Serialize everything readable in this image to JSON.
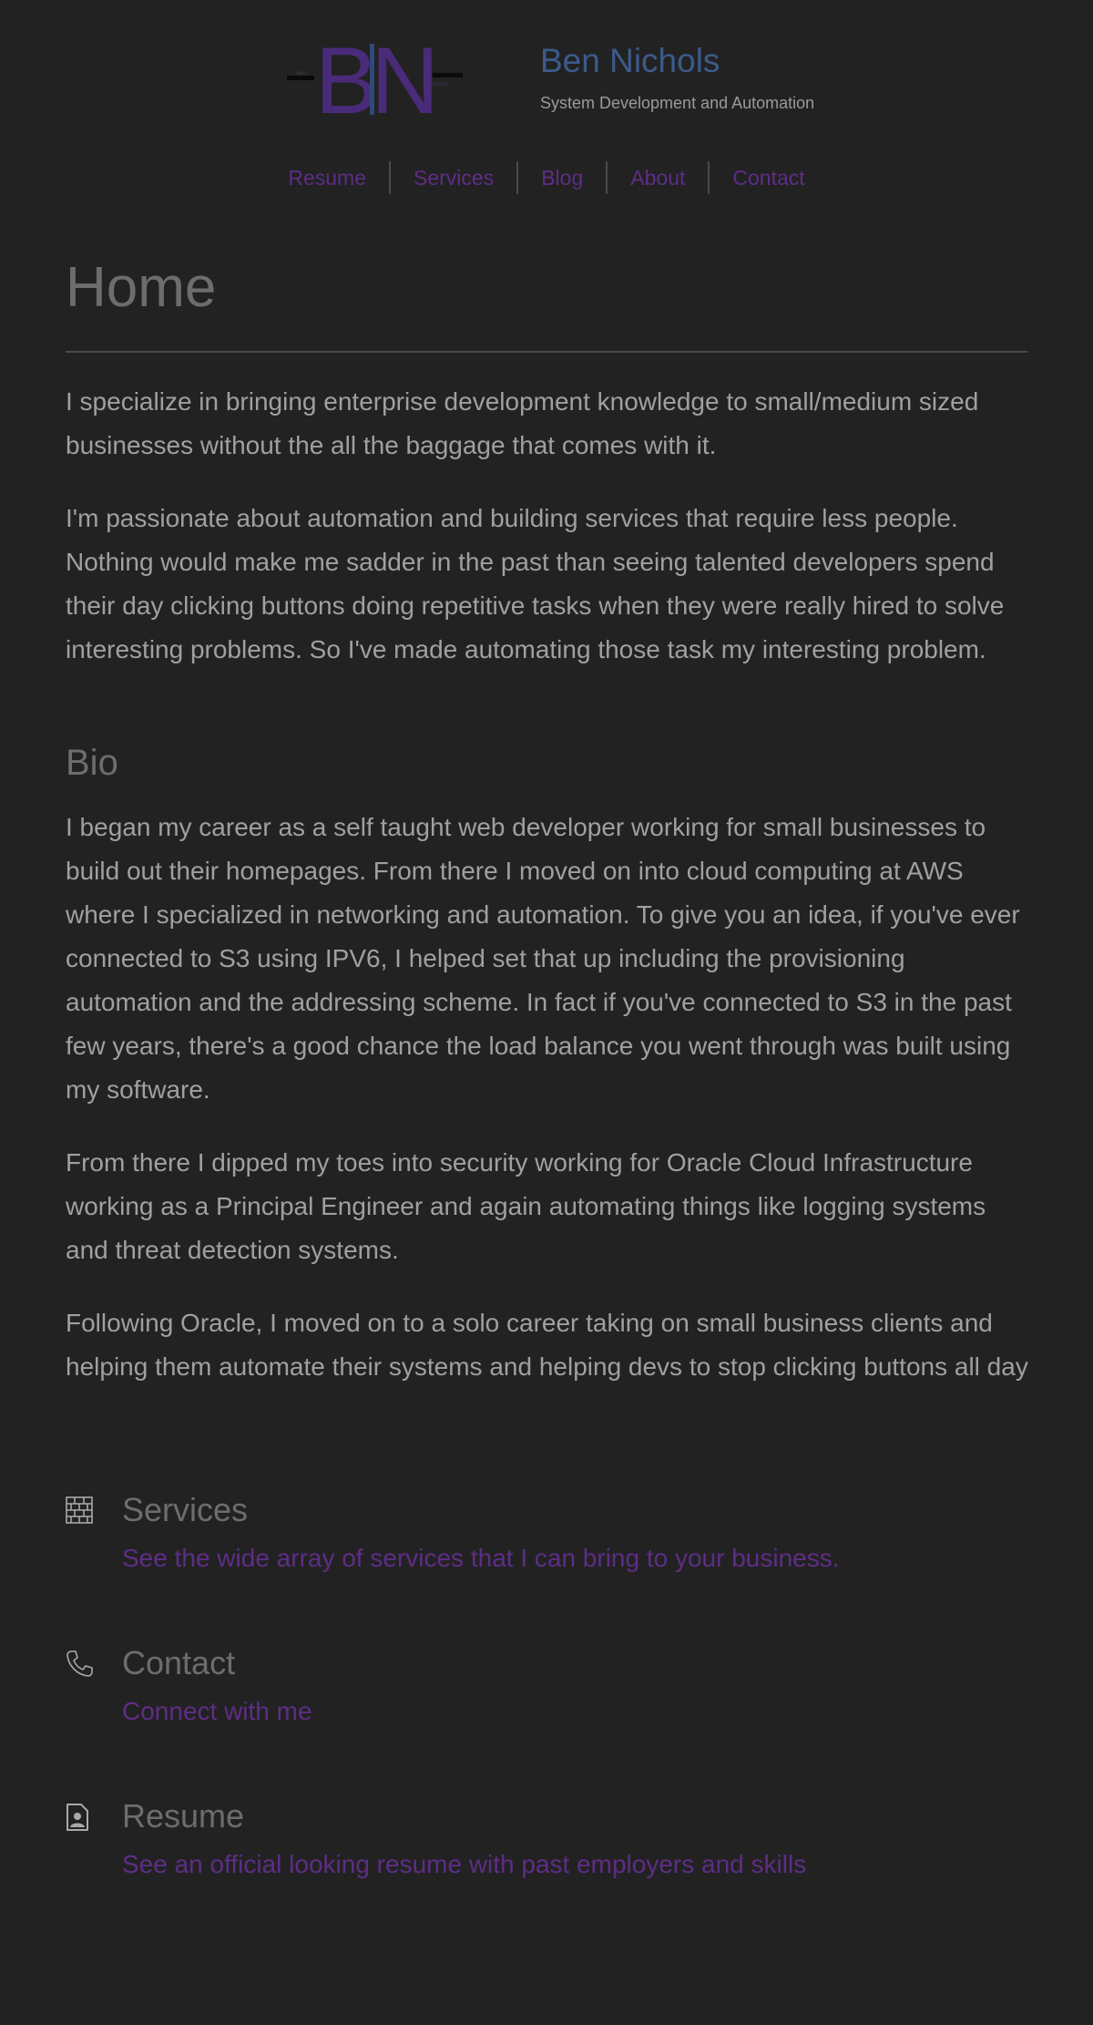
{
  "header": {
    "logo_letters": "BN",
    "logo_left_text": "Ben",
    "logo_right_text": "Nichols",
    "site_title": "Ben Nichols",
    "site_subtitle": "System Development and Automation",
    "brand_color": "#4a2b7a",
    "title_color": "#3c5a8a"
  },
  "nav": {
    "items": [
      {
        "label": "Resume"
      },
      {
        "label": "Services"
      },
      {
        "label": "Blog"
      },
      {
        "label": "About"
      },
      {
        "label": "Contact"
      }
    ],
    "link_color": "#5e2d86"
  },
  "main": {
    "title": "Home",
    "intro_paragraphs": [
      "I specialize in bringing enterprise development knowledge to small/medium sized businesses without the all the baggage that comes with it.",
      "I'm passionate about automation and building services that require less people. Nothing would make me sadder in the past than seeing talented developers spend their day clicking buttons doing repetitive tasks when they were really hired to solve interesting problems. So I've made automating those task my interesting problem."
    ],
    "bio_heading": "Bio",
    "bio_paragraphs": [
      "I began my career as a self taught web developer working for small businesses to build out their homepages. From there I moved on into cloud computing at AWS where I specialized in networking and automation. To give you an idea, if you've ever connected to S3 using IPV6, I helped set that up including the provisioning automation and the addressing scheme. In fact if you've connected to S3 in the past few years, there's a good chance the load balance you went through was built using my software.",
      "From there I dipped my toes into security working for Oracle Cloud Infrastructure working as a Principal Engineer and again automating things like logging systems and threat detection systems.",
      "Following Oracle, I moved on to a solo career taking on small business clients and helping them automate their systems and helping devs to stop clicking buttons all day"
    ]
  },
  "features": [
    {
      "icon": "brick-wall-icon",
      "title": "Services",
      "link": "See the wide array of services that I can bring to your business."
    },
    {
      "icon": "phone-icon",
      "title": "Contact",
      "link": "Connect with me"
    },
    {
      "icon": "resume-document-icon",
      "title": "Resume",
      "link": "See an official looking resume with past employers and skills"
    }
  ]
}
